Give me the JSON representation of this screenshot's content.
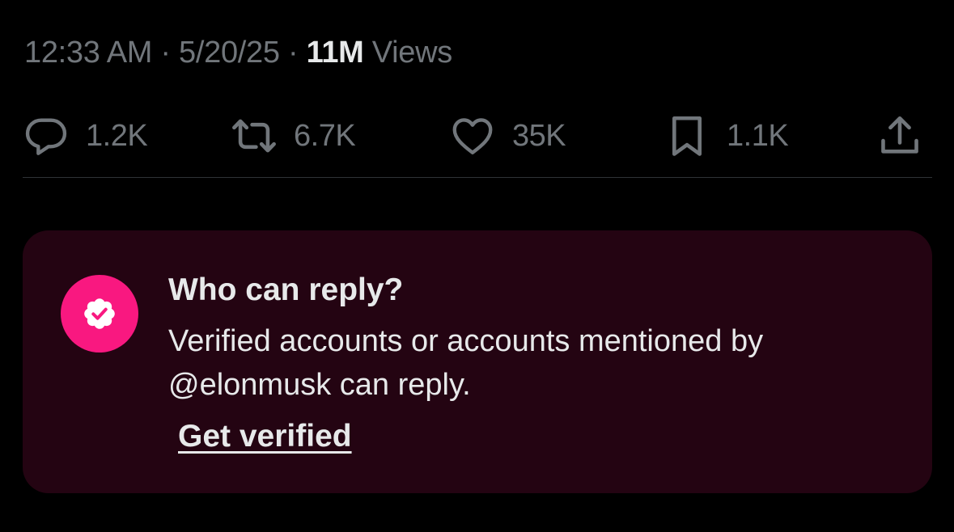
{
  "meta": {
    "time": "12:33 AM",
    "separator": " · ",
    "date": "5/20/25",
    "views_count": "11M",
    "views_label": " Views"
  },
  "actions": {
    "replies": {
      "icon": "reply-icon",
      "count": "1.2K"
    },
    "reposts": {
      "icon": "repost-icon",
      "count": "6.7K"
    },
    "likes": {
      "icon": "heart-icon",
      "count": "35K"
    },
    "bookmarks": {
      "icon": "bookmark-icon",
      "count": "1.1K"
    },
    "share": {
      "icon": "share-icon"
    }
  },
  "reply_restriction": {
    "icon": "verified-badge-icon",
    "title": "Who can reply?",
    "description": "Verified accounts or accounts mentioned by @elonmusk can reply.",
    "link_label": "Get verified"
  },
  "colors": {
    "background": "#000000",
    "muted_text": "#71767b",
    "primary_text": "#e7e9ea",
    "card_background": "#240412",
    "accent_pink": "#f91880",
    "divider": "#2f3336"
  }
}
